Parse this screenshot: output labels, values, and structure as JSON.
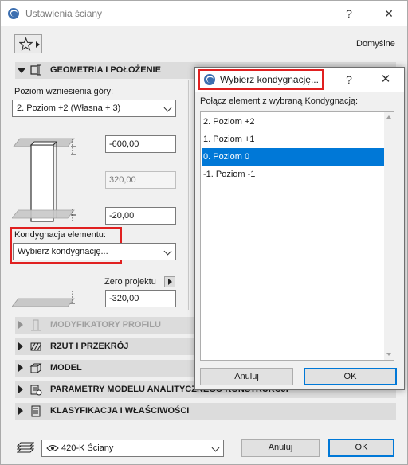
{
  "window": {
    "title": "Ustawienia ściany",
    "help": "?",
    "close": "✕",
    "defaults_label": "Domyślne",
    "favorites_icon": "star-icon"
  },
  "geometry": {
    "section_title": "GEOMETRIA I POŁOŻENIE",
    "top_level_label": "Poziom wzniesienia góry:",
    "top_level_value": "2. Poziom +2 (Własna + 3)",
    "top_offset": "-600,00",
    "height": "320,00",
    "bottom_offset": "-20,00",
    "story_label": "Kondygnacja elementu:",
    "story_value": "Wybierz kondygnację...",
    "zero_label": "Zero projektu",
    "zero_value": "-320,00"
  },
  "sections": [
    {
      "label": "MODYFIKATORY PROFILU",
      "icon": "profile-icon",
      "enabled": false
    },
    {
      "label": "RZUT I PRZEKRÓJ",
      "icon": "floor-plan-icon",
      "enabled": true
    },
    {
      "label": "MODEL",
      "icon": "model-icon",
      "enabled": true
    },
    {
      "label": "PARAMETRY MODELU ANALITYCZNEGO KONSTRUKCJI",
      "icon": "analytical-icon",
      "enabled": true
    },
    {
      "label": "KLASYFIKACJA I WŁAŚCIWOŚCI",
      "icon": "classification-icon",
      "enabled": true
    }
  ],
  "footer": {
    "layer_value": "420-K Ściany",
    "cancel": "Anuluj",
    "ok": "OK"
  },
  "dialog": {
    "title": "Wybierz kondygnację...",
    "help": "?",
    "close": "✕",
    "prompt": "Połącz element z wybraną Kondygnacją:",
    "items": [
      "2. Poziom +2",
      "1. Poziom +1",
      "0. Poziom 0",
      "-1. Poziom -1"
    ],
    "selected_index": 2,
    "cancel": "Anuluj",
    "ok": "OK"
  },
  "colors": {
    "accent": "#0078d7",
    "highlight": "#e02020"
  }
}
